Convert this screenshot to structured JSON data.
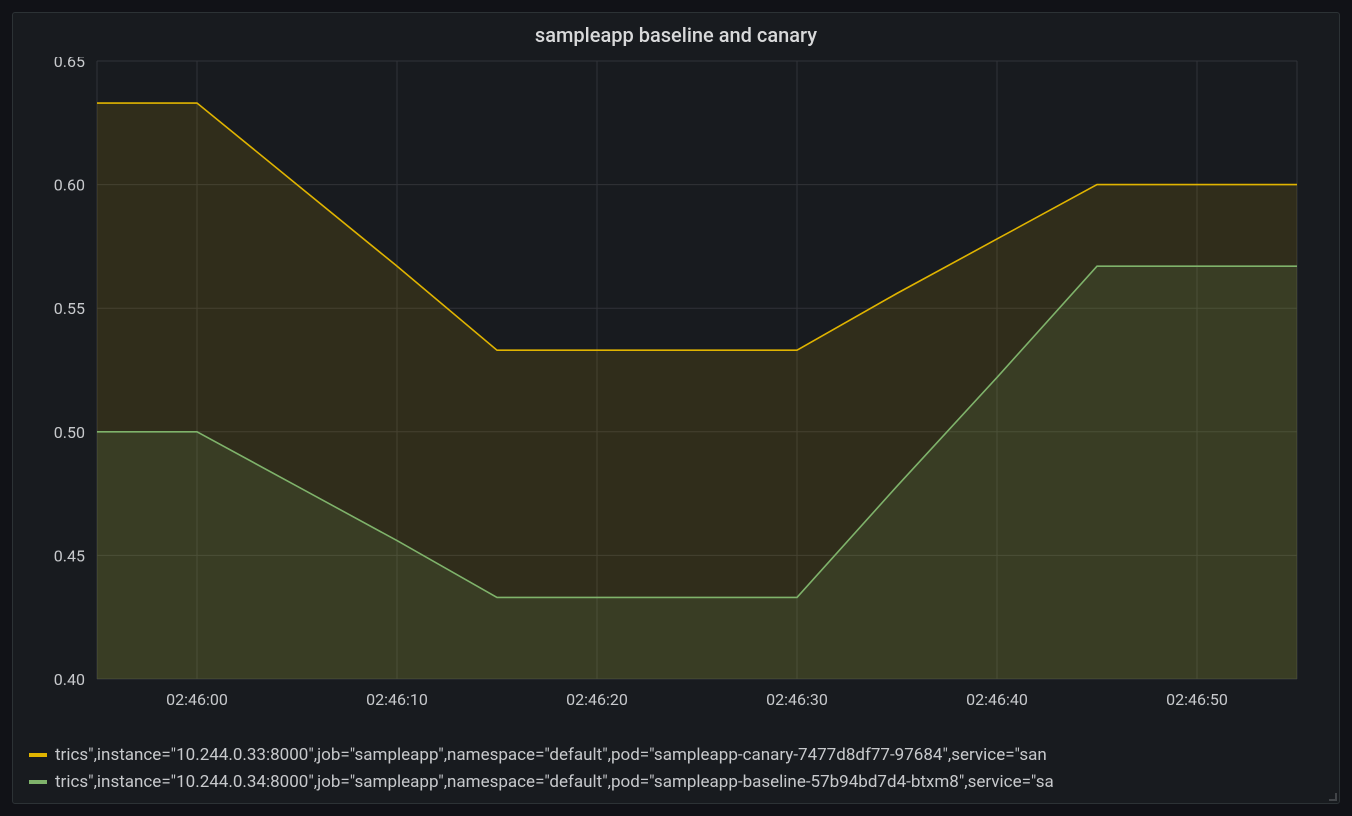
{
  "panel": {
    "title": "sampleapp baseline and canary"
  },
  "legend": [
    {
      "color": "#e0b400",
      "text": "trics\",instance=\"10.244.0.33:8000\",job=\"sampleapp\",namespace=\"default\",pod=\"sampleapp-canary-7477d8df77-97684\",service=\"san"
    },
    {
      "color": "#7fb36b",
      "text": "trics\",instance=\"10.244.0.34:8000\",job=\"sampleapp\",namespace=\"default\",pod=\"sampleapp-baseline-57b94bd7d4-btxm8\",service=\"sa"
    }
  ],
  "chart_data": {
    "type": "area",
    "title": "sampleapp baseline and canary",
    "xlabel": "",
    "ylabel": "",
    "ylim": [
      0.4,
      0.65
    ],
    "y_ticks": [
      0.4,
      0.45,
      0.5,
      0.55,
      0.6,
      0.65
    ],
    "x_ticks": [
      "02:46:00",
      "02:46:10",
      "02:46:20",
      "02:46:30",
      "02:46:40",
      "02:46:50"
    ],
    "x_seconds": [
      -5,
      0,
      5,
      10,
      15,
      20,
      25,
      30,
      35,
      40,
      45,
      50,
      55
    ],
    "series": [
      {
        "name": "canary",
        "color": "#e0b400",
        "fill": "rgba(224,180,0,0.12)",
        "values": [
          0.633,
          0.633,
          0.6,
          0.567,
          0.533,
          0.533,
          0.533,
          0.533,
          0.556,
          0.578,
          0.6,
          0.6,
          0.6
        ]
      },
      {
        "name": "baseline",
        "color": "#7fb36b",
        "fill": "rgba(127,179,107,0.12)",
        "values": [
          0.5,
          0.5,
          0.478,
          0.456,
          0.433,
          0.433,
          0.433,
          0.433,
          0.478,
          0.522,
          0.567,
          0.567,
          0.567
        ]
      }
    ]
  }
}
